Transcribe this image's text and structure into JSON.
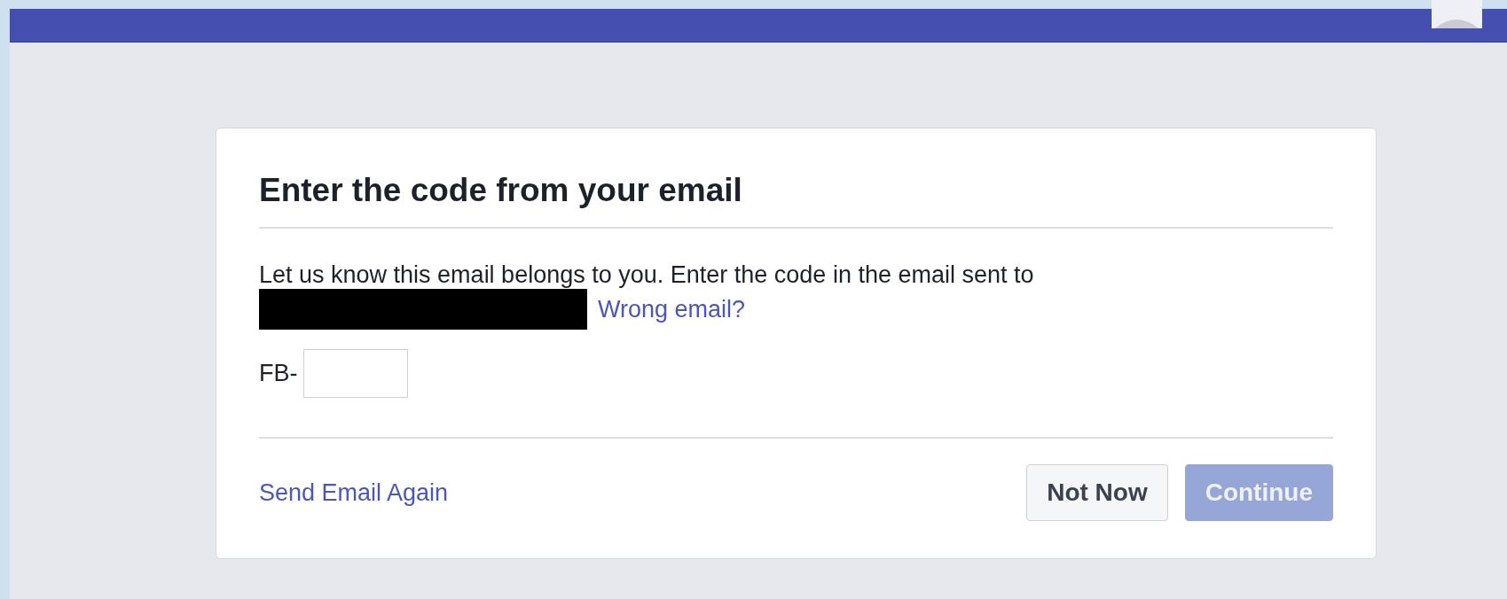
{
  "dialog": {
    "title": "Enter the code from your email",
    "message": "Let us know this email belongs to you. Enter the code in the email sent to",
    "wrong_email_link": "Wrong email?",
    "code_field": {
      "prefix": "FB-"
    },
    "send_again_link": "Send Email Again",
    "buttons": [
      {
        "label": "Not Now",
        "kind": "secondary",
        "disabled": false
      },
      {
        "label": "Continue",
        "kind": "primary",
        "disabled": true
      }
    ]
  }
}
